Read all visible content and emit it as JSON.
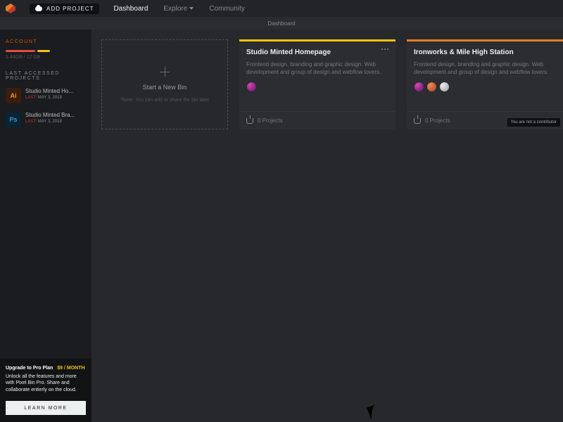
{
  "topbar": {
    "add_project": "ADD PROJECT",
    "nav": {
      "dashboard": "Dashboard",
      "explore": "Explore",
      "community": "Community"
    }
  },
  "subbar": {
    "label": "Dashboard"
  },
  "sidebar": {
    "account_label": "ACCOUNT",
    "storage": "1.44GB / 12 GB",
    "recent_label": "LAST ACCESSED PROJECTS",
    "projects": [
      {
        "app": "Ai",
        "name": "Studio Minted Ho...",
        "last_label": "LAST:",
        "date": "MAY 3, 2018"
      },
      {
        "app": "Ps",
        "name": "Studio Minted Bra...",
        "last_label": "LAST:",
        "date": "MAY 3, 2018"
      }
    ],
    "promo": {
      "title": "Upgrade to Pro Plan",
      "price": "$9 / MONTH",
      "body": "Unlock all the features and more with Pixel Bin Pro. Share and collaborate entierly on the cloud.",
      "cta": "LEARN MORE"
    }
  },
  "main": {
    "newbin": {
      "title": "Start a New Bin",
      "note": "*Note: You can add or share the bin later"
    },
    "cards": [
      {
        "title": "Studio Minted Homepage",
        "desc": "Frontend design, branding and graphic design. Web development and group of design and webflow lovers.",
        "projects": "0 Projects"
      },
      {
        "title": "Ironworks & Mile High Station",
        "desc": "Frontend design, branding and graphic design. Web development and group of design and webflow lovers.",
        "projects": "0 Projects",
        "tooltip": "You are not a contributor"
      }
    ]
  }
}
